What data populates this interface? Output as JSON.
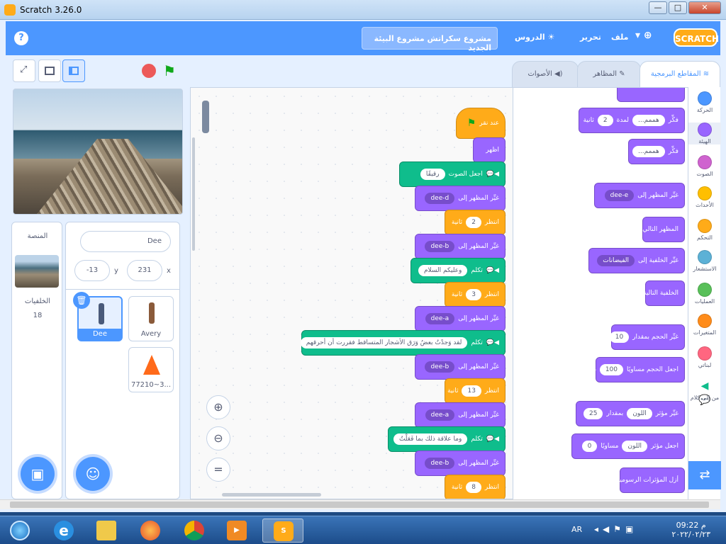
{
  "window": {
    "title": "Scratch 3.26.0",
    "min": "—",
    "max": "□",
    "close": "✕"
  },
  "menu": {
    "help": "?",
    "project_title": "مشروع سكراتش مشروع البيئة الجديد",
    "tutorials": "الدروس",
    "edit": "تحرير",
    "file": "ملف",
    "logo": "SCRATCH"
  },
  "tabs": {
    "code": "المقاطع البرمجية",
    "costumes": "المظاهر",
    "sounds": "الأصوات"
  },
  "sprite_info": {
    "name": "Dee",
    "x_label": "x",
    "x": "231",
    "y_label": "y",
    "y": "-13"
  },
  "sprites": [
    {
      "name": "Dee"
    },
    {
      "name": "Avery"
    },
    {
      "name": "77210~3..."
    }
  ],
  "stage_pane": {
    "title": "المنصة",
    "backdrops_label": "الخلفيات",
    "backdrops_count": "18"
  },
  "categories": [
    {
      "label": "الحركة",
      "color": "#4c97ff"
    },
    {
      "label": "الهيئة",
      "color": "#9966ff"
    },
    {
      "label": "الصوت",
      "color": "#cf63cf"
    },
    {
      "label": "الأحداث",
      "color": "#ffbf00"
    },
    {
      "label": "التحكم",
      "color": "#ffab19"
    },
    {
      "label": "الاستشعار",
      "color": "#5cb1d6"
    },
    {
      "label": "العمليات",
      "color": "#59c059"
    },
    {
      "label": "المتغيرات",
      "color": "#ff8c1a"
    },
    {
      "label": "لبناتي",
      "color": "#ff6680"
    },
    {
      "label": "من إلى كلام",
      "color": "#0fbd8c"
    }
  ],
  "script": {
    "hat": "عند نقر",
    "b1": "اظهر",
    "b2": {
      "label": "اجعل الصوت",
      "value": "رقيقًا"
    },
    "b3": {
      "label": "غيِّر المظهر إلى",
      "value": "dee-d"
    },
    "b4": {
      "label": "انتظر",
      "value": "2",
      "unit": "ثانية"
    },
    "b5": {
      "label": "غيِّر المظهر إلى",
      "value": "dee-b"
    },
    "b6": {
      "label": "تكلم",
      "value": "وعليكم السلام"
    },
    "b7": {
      "label": "انتظر",
      "value": "3",
      "unit": "ثانية"
    },
    "b8": {
      "label": "غيِّر المظهر إلى",
      "value": "dee-a"
    },
    "b9": {
      "label": "تكلم",
      "value": "لقد وَجدْتُ بعضُ وَرَق الأشجار المتساقط فقررت أن أحرقهم"
    },
    "b10": {
      "label": "غيِّر المظهر إلى",
      "value": "dee-b"
    },
    "b11": {
      "label": "انتظر",
      "value": "13",
      "unit": "ثانية"
    },
    "b12": {
      "label": "غيِّر المظهر إلى",
      "value": "dee-a"
    },
    "b13": {
      "label": "تكلم",
      "value": "وما علاقة ذلك بما فَعَلْتُ"
    },
    "b14": {
      "label": "غيِّر المظهر إلى",
      "value": "dee-b"
    },
    "b15": {
      "label": "انتظر",
      "value": "8",
      "unit": "ثانية"
    }
  },
  "palette": {
    "p0": "",
    "p1": {
      "label": "فكِّر",
      "value": "هممم...",
      "mid": "لمدة",
      "num": "2",
      "unit": "ثانية"
    },
    "p2": {
      "label": "فكِّر",
      "value": "هممم..."
    },
    "p3": {
      "label": "غيِّر المظهر إلى",
      "value": "dee-e"
    },
    "p4": "المظهر التالي",
    "p5": {
      "label": "غيِّر الخلفية إلى",
      "value": "الفيضانات"
    },
    "p6": "الخلفية التالية",
    "p7": {
      "label": "غيِّر الحجم بمقدار",
      "value": "10"
    },
    "p8": {
      "label": "اجعل الحجم مساويًا",
      "value": "100",
      "unit": "%"
    },
    "p9": {
      "label": "غيِّر مؤثر",
      "dd": "اللون",
      "mid": "بمقدار",
      "value": "25"
    },
    "p10": {
      "label": "اجعل مؤثر",
      "dd": "اللون",
      "mid": "مساويًا",
      "value": "0"
    },
    "p11": "أزل المؤثرات الرسومية"
  },
  "taskbar": {
    "lang": "AR",
    "time": "09:22 م",
    "date": "٢٠٢٢/٠٢/٢٣"
  }
}
